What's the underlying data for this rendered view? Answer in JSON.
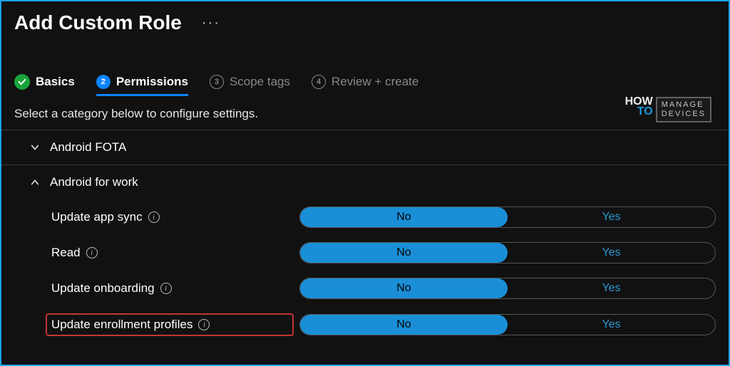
{
  "header": {
    "title": "Add Custom Role",
    "more_label": "···"
  },
  "tabs": [
    {
      "label": "Basics",
      "state": "done"
    },
    {
      "num": "2",
      "label": "Permissions",
      "state": "active"
    },
    {
      "num": "3",
      "label": "Scope tags",
      "state": "pending"
    },
    {
      "num": "4",
      "label": "Review + create",
      "state": "pending"
    }
  ],
  "instruction": "Select a category below to configure settings.",
  "categories": [
    {
      "label": "Android FOTA",
      "expanded": false
    },
    {
      "label": "Android for work",
      "expanded": true
    }
  ],
  "permissions": [
    {
      "label": "Update app sync",
      "value": "No",
      "highlighted": false
    },
    {
      "label": "Read",
      "value": "No",
      "highlighted": false
    },
    {
      "label": "Update onboarding",
      "value": "No",
      "highlighted": false
    },
    {
      "label": "Update enrollment profiles",
      "value": "No",
      "highlighted": true
    }
  ],
  "toggle_options": {
    "no": "No",
    "yes": "Yes"
  },
  "watermark": {
    "left_top": "HOW",
    "left_bottom": "TO",
    "right_line1": "MANAGE",
    "right_line2": "DEVICES"
  }
}
